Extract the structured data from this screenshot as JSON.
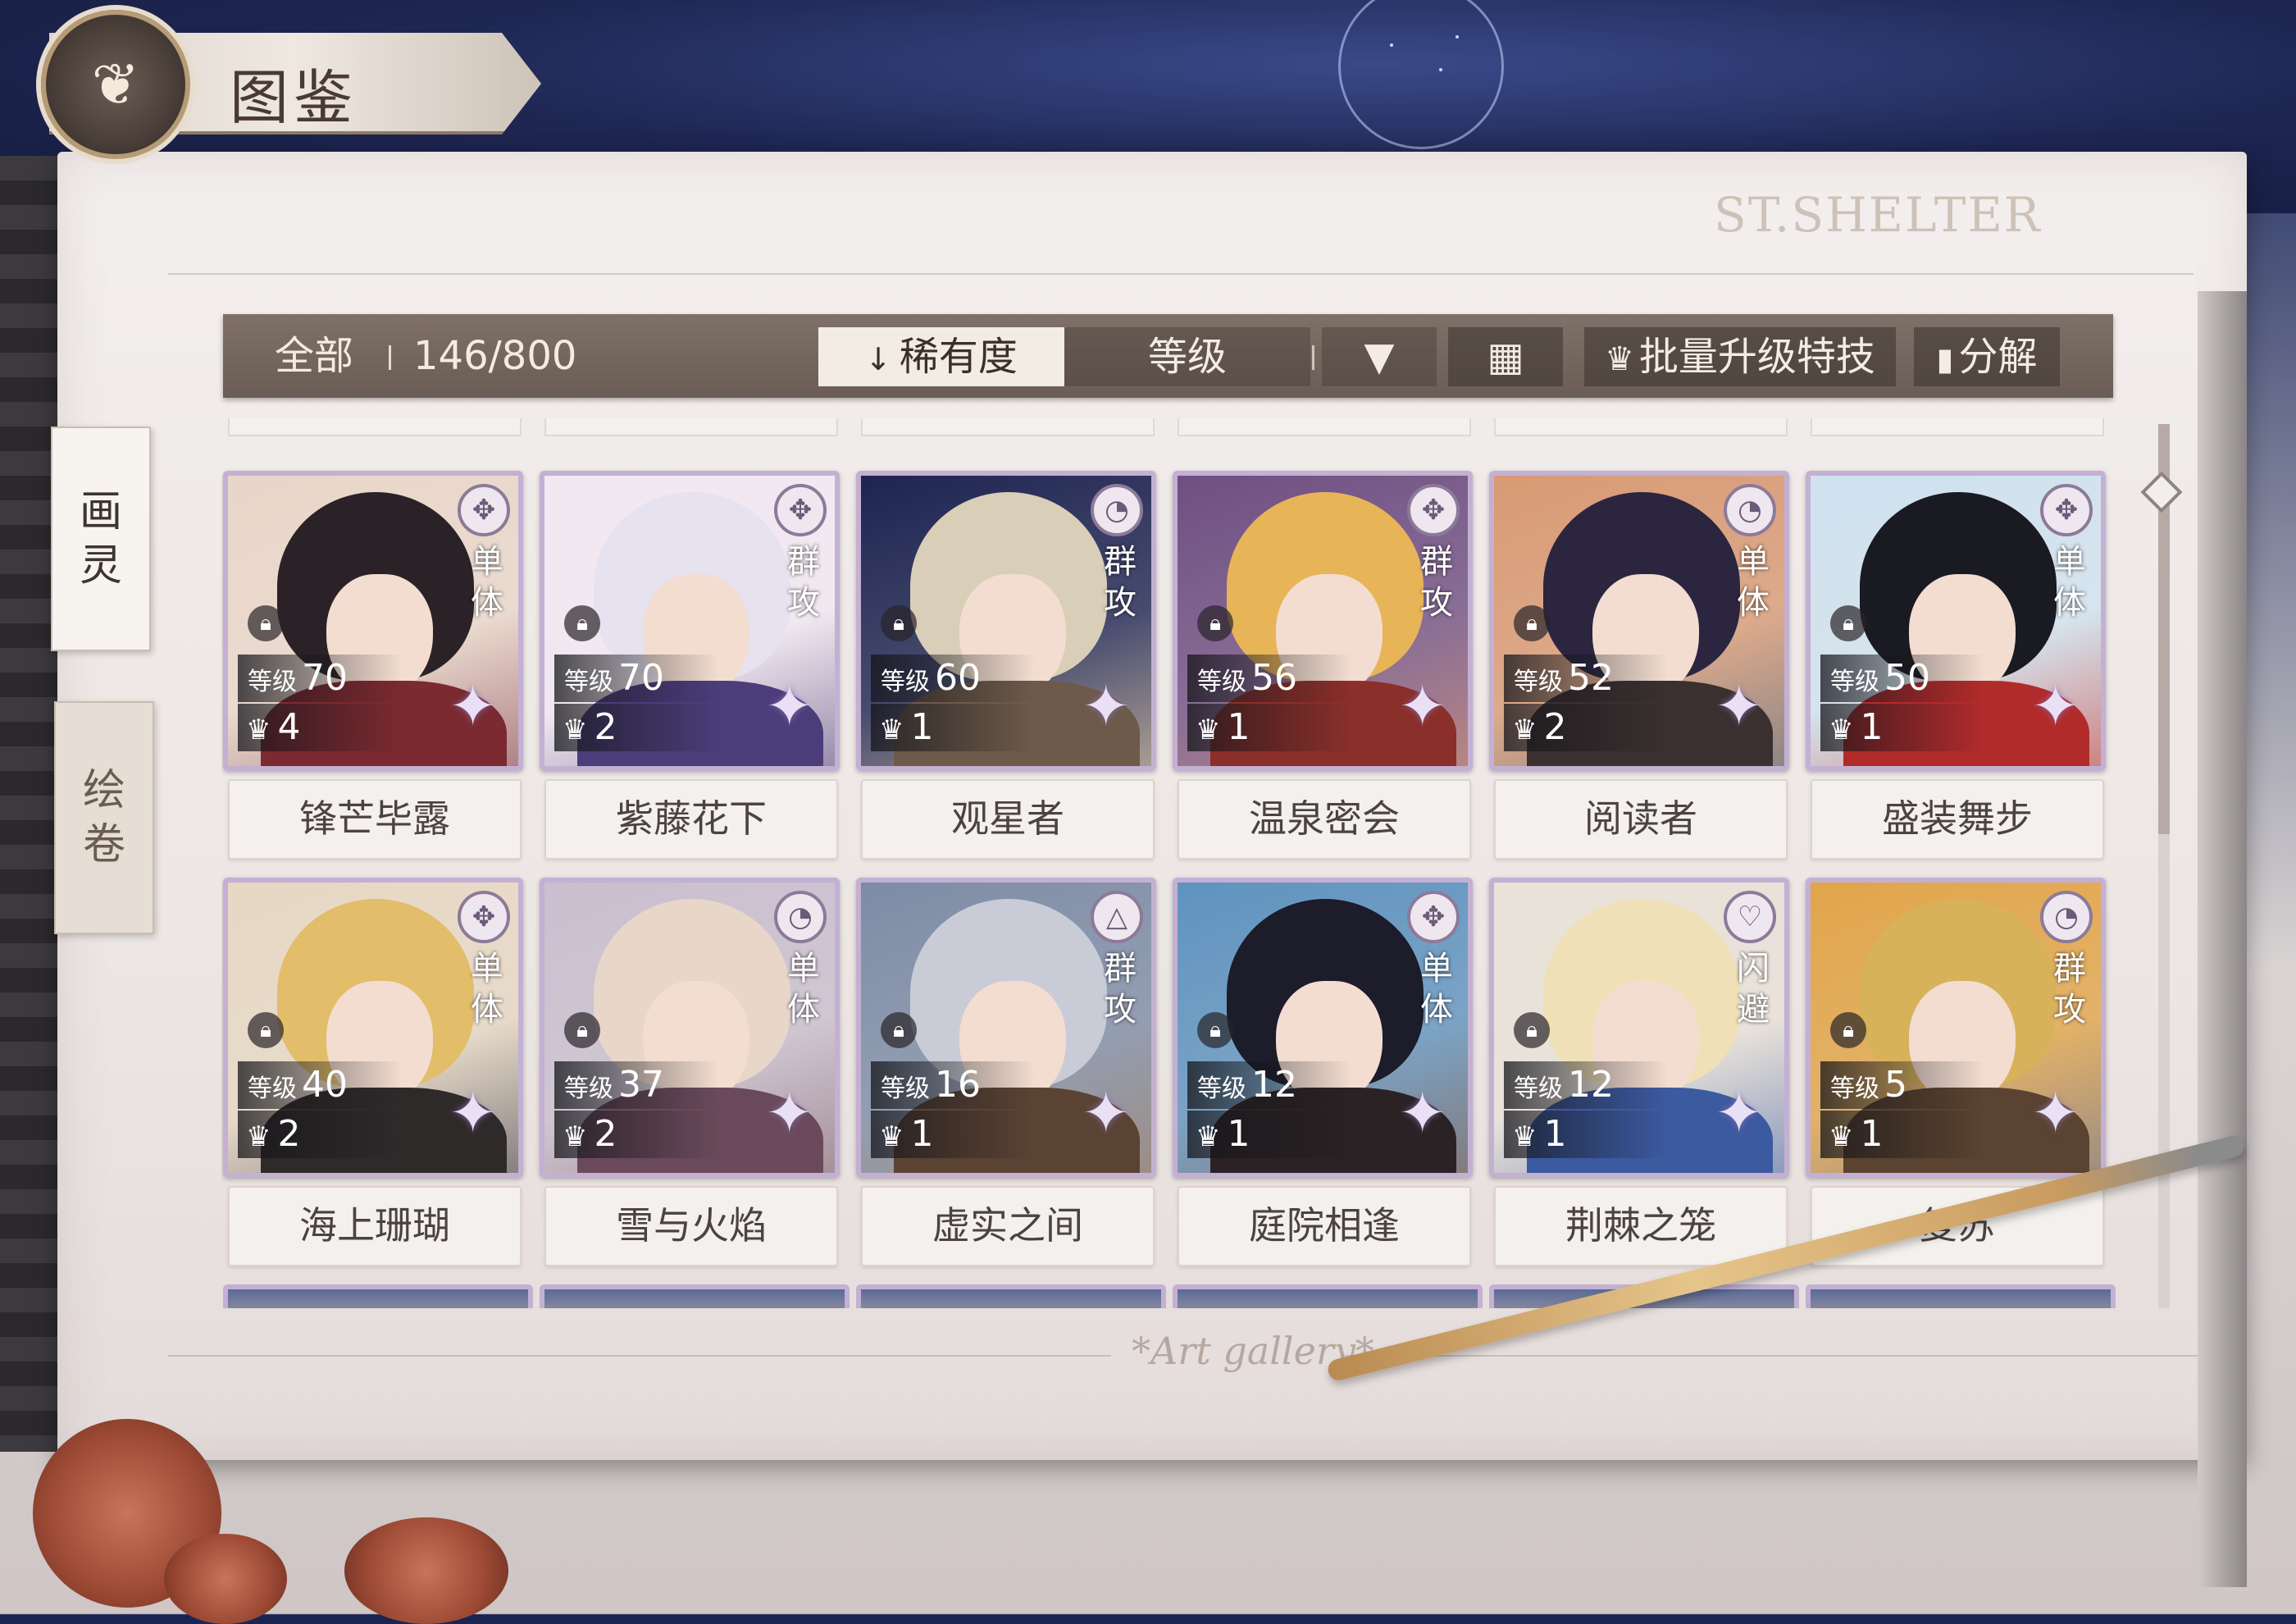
{
  "header": {
    "title": "图鉴"
  },
  "watermark": "ST.SHELTER",
  "footer_mark": "*Art gallery*",
  "side_tabs": [
    {
      "label": "画灵",
      "chars": [
        "画",
        "灵"
      ],
      "active": true
    },
    {
      "label": "绘卷",
      "chars": [
        "绘",
        "卷"
      ],
      "active": false
    }
  ],
  "toolbar": {
    "filter_all": "全部",
    "count": "146/800",
    "sort_rarity": "稀有度",
    "sort_level": "等级",
    "batch_upgrade": "批量升级特技",
    "decompose": "分解"
  },
  "labels": {
    "level": "等级"
  },
  "colors": {
    "toolbar": "#6f625a",
    "card_frame": "#c3b0d3",
    "page": "#efebe9"
  },
  "cards": [
    {
      "name": "锋芒毕露",
      "type": "单体",
      "level": "70",
      "stars": "4",
      "icon": "attack-emblem-icon"
    },
    {
      "name": "紫藤花下",
      "type": "群攻",
      "level": "70",
      "stars": "2",
      "icon": "attack-emblem-icon"
    },
    {
      "name": "观星者",
      "type": "群攻",
      "level": "60",
      "stars": "1",
      "icon": "wheel-emblem-icon"
    },
    {
      "name": "温泉密会",
      "type": "群攻",
      "level": "56",
      "stars": "1",
      "icon": "attack-emblem-icon"
    },
    {
      "name": "阅读者",
      "type": "单体",
      "level": "52",
      "stars": "2",
      "icon": "wheel-emblem-icon"
    },
    {
      "name": "盛装舞步",
      "type": "单体",
      "level": "50",
      "stars": "1",
      "icon": "attack-emblem-icon"
    },
    {
      "name": "海上珊瑚",
      "type": "单体",
      "level": "40",
      "stars": "2",
      "icon": "attack-emblem-icon"
    },
    {
      "name": "雪与火焰",
      "type": "单体",
      "level": "37",
      "stars": "2",
      "icon": "wheel-emblem-icon"
    },
    {
      "name": "虚实之间",
      "type": "群攻",
      "level": "16",
      "stars": "1",
      "icon": "triangle-emblem-icon"
    },
    {
      "name": "庭院相逢",
      "type": "单体",
      "level": "12",
      "stars": "1",
      "icon": "attack-emblem-icon"
    },
    {
      "name": "荆棘之笼",
      "type": "闪避",
      "level": "12",
      "stars": "1",
      "icon": "heart-emblem-icon"
    },
    {
      "name": "复苏",
      "type": "群攻",
      "level": "5",
      "stars": "1",
      "icon": "wheel-emblem-icon"
    }
  ]
}
